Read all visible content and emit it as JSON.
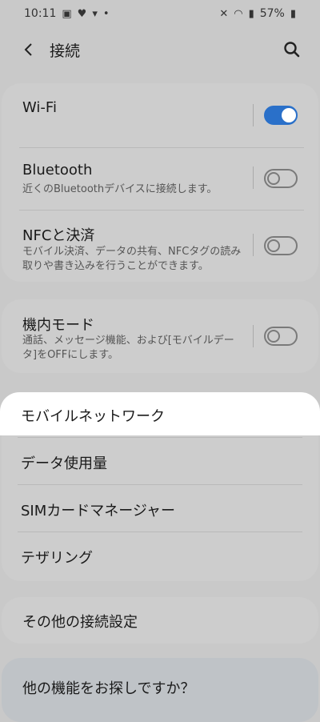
{
  "status": {
    "time": "10:11",
    "battery": "57%",
    "icons_left": [
      "image-icon",
      "heart-icon",
      "bag-icon",
      "dot-icon"
    ],
    "icons_right": [
      "mute-icon",
      "wifi-icon",
      "signal-icon",
      "battery-icon"
    ]
  },
  "header": {
    "title": "接続"
  },
  "sections": {
    "wifi": {
      "title": "Wi-Fi",
      "enabled": true
    },
    "bluetooth": {
      "title": "Bluetooth",
      "subtitle": "近くのBluetoothデバイスに接続します。",
      "enabled": false
    },
    "nfc": {
      "title": "NFCと決済",
      "subtitle": "モバイル決済、データの共有、NFCタグの読み取りや書き込みを行うことができます。",
      "enabled": false
    },
    "airplane": {
      "title": "機内モード",
      "subtitle": "通話、メッセージ機能、および[モバイルデータ]をOFFにします。",
      "enabled": false
    }
  },
  "list": {
    "mobile_network": "モバイルネットワーク",
    "data_usage": "データ使用量",
    "sim_manager": "SIMカードマネージャー",
    "tethering": "テザリング"
  },
  "more_settings": "その他の接続設定",
  "looking_for": "他の機能をお探しですか？",
  "colors": {
    "accent": "#2a70c9",
    "background": "#c9c9c9",
    "highlight": "#ffffff"
  }
}
